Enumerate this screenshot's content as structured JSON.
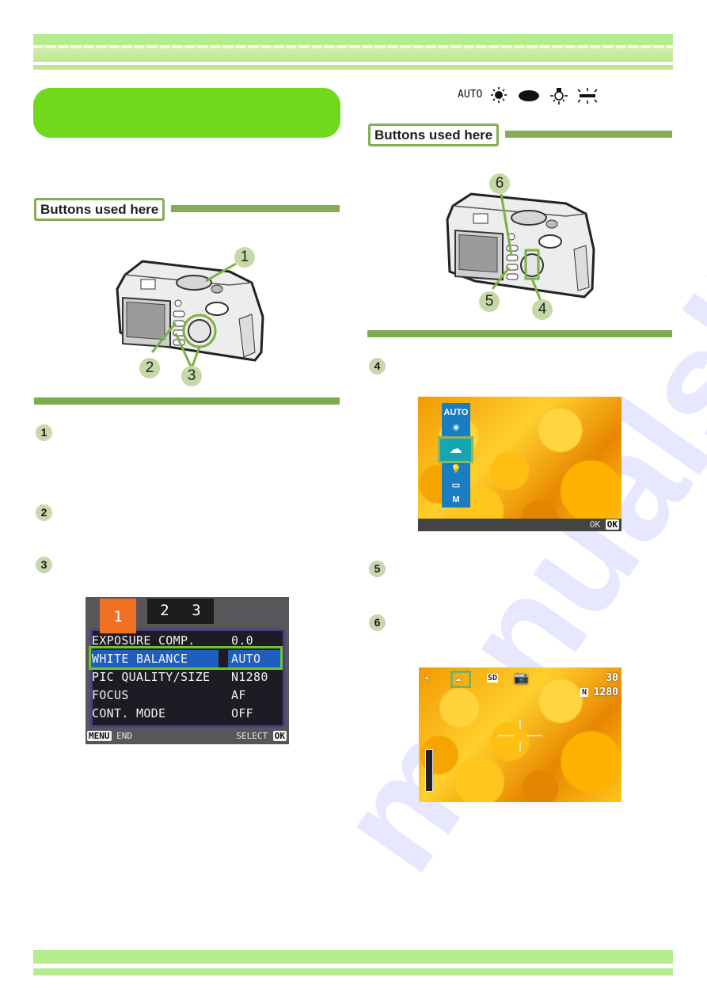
{
  "section_left": {
    "label": "Buttons used here",
    "callouts": [
      "1",
      "2",
      "3"
    ]
  },
  "section_right": {
    "label": "Buttons used here",
    "callouts": [
      "6",
      "5",
      "4"
    ]
  },
  "wb_legend": {
    "auto_label": "AUTO",
    "icons": [
      "outdoors-sun-icon",
      "cloudy-icon",
      "incandescent-icon",
      "fluorescent-icon"
    ]
  },
  "steps_left": [
    {
      "number": "1"
    },
    {
      "number": "2"
    },
    {
      "number": "3"
    }
  ],
  "steps_right": [
    {
      "number": "4"
    },
    {
      "number": "5"
    },
    {
      "number": "6"
    }
  ],
  "menu_screen": {
    "tabs": [
      "1",
      "2",
      "3"
    ],
    "rows": [
      {
        "key": "EXPOSURE COMP.",
        "value": "0.0"
      },
      {
        "key": "WHITE BALANCE",
        "value": "AUTO",
        "selected": true
      },
      {
        "key": "PIC QUALITY/SIZE",
        "value": "N1280"
      },
      {
        "key": "FOCUS",
        "value": "AF"
      },
      {
        "key": "CONT. MODE",
        "value": "OFF"
      }
    ],
    "footer_left_badge": "MENU",
    "footer_left_text": "END",
    "footer_right_text": "SELECT",
    "footer_right_badge": "OK"
  },
  "wb_select_screen": {
    "items": [
      "AUTO",
      "☀",
      "☁",
      "💡",
      "▭",
      "M"
    ],
    "selected_index": 2,
    "footer_text": "OK",
    "footer_badge": "OK"
  },
  "shooting_screen": {
    "icons": [
      "flash-off-icon",
      "cloudy-wb-icon",
      "sd-card-icon",
      "camera-mode-icon"
    ],
    "sd_label": "SD",
    "remaining": "30",
    "quality_badge": "N",
    "size": "1280"
  },
  "colors": {
    "band": "#b6ec8d",
    "title_pill": "#72d81c",
    "rule": "#86ad55",
    "highlight": "#6cc52a"
  }
}
